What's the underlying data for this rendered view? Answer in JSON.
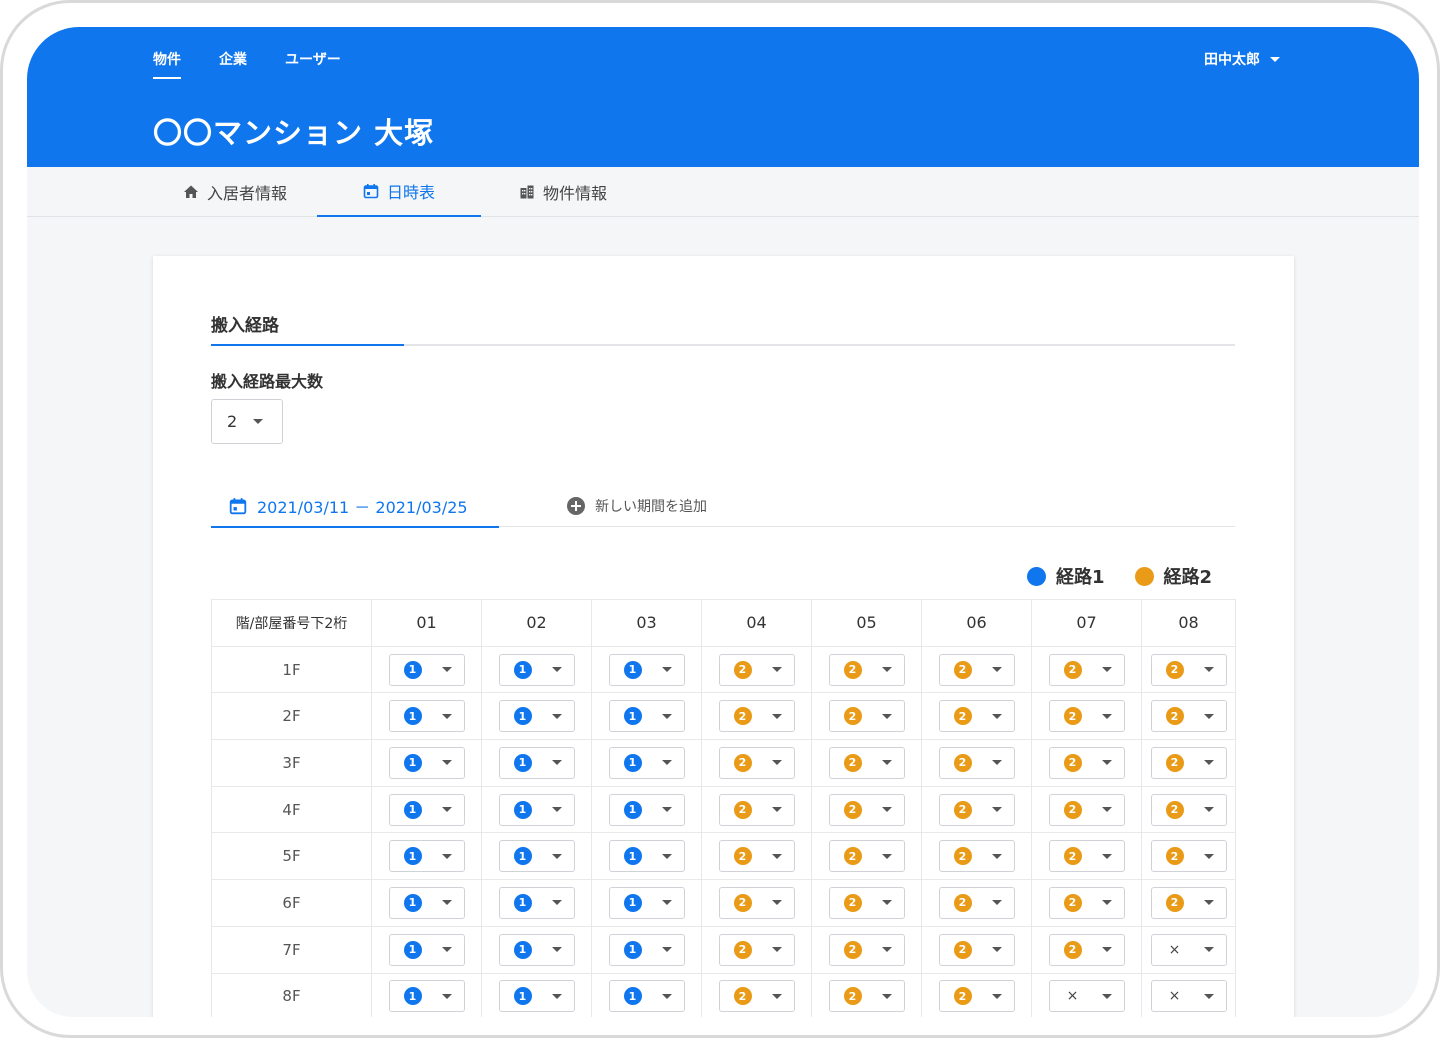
{
  "header": {
    "nav": [
      "物件",
      "企業",
      "ユーザー"
    ],
    "user_name": "田中太郎",
    "title": "〇〇マンション 大塚"
  },
  "tabs": [
    {
      "label": "入居者情報",
      "icon": "home-icon",
      "active": false
    },
    {
      "label": "日時表",
      "icon": "calendar-icon",
      "active": true
    },
    {
      "label": "物件情報",
      "icon": "building-icon",
      "active": false
    }
  ],
  "section": {
    "title": "搬入経路",
    "max_label": "搬入経路最大数",
    "max_value": "2"
  },
  "period": {
    "current": "2021/03/11 － 2021/03/25",
    "add_label": "新しい期間を追加"
  },
  "legend": [
    {
      "label": "経路1",
      "color": "#0f76ee"
    },
    {
      "label": "経路2",
      "color": "#e99a16"
    }
  ],
  "table": {
    "corner": "階/部屋番号下2桁",
    "columns": [
      "01",
      "02",
      "03",
      "04",
      "05",
      "06",
      "07",
      "08"
    ],
    "rows": [
      {
        "floor": "1F",
        "values": [
          "1",
          "1",
          "1",
          "2",
          "2",
          "2",
          "2",
          "2"
        ]
      },
      {
        "floor": "2F",
        "values": [
          "1",
          "1",
          "1",
          "2",
          "2",
          "2",
          "2",
          "2"
        ]
      },
      {
        "floor": "3F",
        "values": [
          "1",
          "1",
          "1",
          "2",
          "2",
          "2",
          "2",
          "2"
        ]
      },
      {
        "floor": "4F",
        "values": [
          "1",
          "1",
          "1",
          "2",
          "2",
          "2",
          "2",
          "2"
        ]
      },
      {
        "floor": "5F",
        "values": [
          "1",
          "1",
          "1",
          "2",
          "2",
          "2",
          "2",
          "2"
        ]
      },
      {
        "floor": "6F",
        "values": [
          "1",
          "1",
          "1",
          "2",
          "2",
          "2",
          "2",
          "2"
        ]
      },
      {
        "floor": "7F",
        "values": [
          "1",
          "1",
          "1",
          "2",
          "2",
          "2",
          "2",
          "×"
        ]
      },
      {
        "floor": "8F",
        "values": [
          "1",
          "1",
          "1",
          "2",
          "2",
          "2",
          "×",
          "×"
        ]
      }
    ]
  }
}
